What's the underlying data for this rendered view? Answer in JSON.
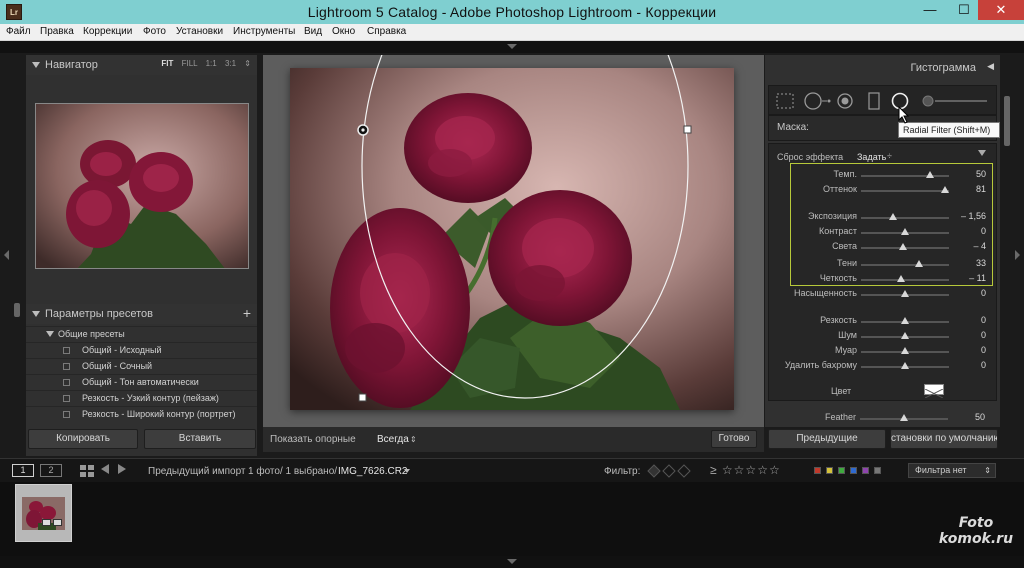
{
  "window": {
    "title": "Lightroom 5 Catalog - Adobe Photoshop Lightroom - Коррекции",
    "app_icon_text": "Lr",
    "minimize": "—",
    "maximize": "☐",
    "close": "✕"
  },
  "menu": [
    "Файл",
    "Правка",
    "Коррекции",
    "Фото",
    "Установки",
    "Инструменты",
    "Вид",
    "Окно",
    "Справка"
  ],
  "navigator": {
    "title": "Навигатор",
    "options": [
      "FIT",
      "FILL",
      "1:1",
      "3:1"
    ],
    "options_arrow": "⇕"
  },
  "presets": {
    "title": "Параметры пресетов",
    "add_icon": "+",
    "folder": "Общие пресеты",
    "items": [
      "Общий - Исходный",
      "Общий - Сочный",
      "Общий - Тон автоматически",
      "Резкость - Узкий контур (пейзаж)",
      "Резкость - Широкий контур (портрет)"
    ]
  },
  "left_buttons": {
    "copy": "Копировать",
    "paste": "Вставить"
  },
  "toolbar": {
    "show_pins_label": "Показать опорные",
    "show_pins_value": "Всегда",
    "done": "Готово"
  },
  "histogram": {
    "title": "Гистограмма",
    "arrow": "◀"
  },
  "tooltip": "Radial Filter (Shift+M)",
  "mask_label": "Маска:",
  "effect": {
    "reset": "Сброс эффекта",
    "preset": "Задать",
    "preset_arrow": "÷"
  },
  "sliders": [
    {
      "label": "Темп.",
      "value": "50",
      "pos": 0.78
    },
    {
      "label": "Оттенок",
      "value": "81",
      "pos": 0.95
    },
    {
      "label": "Экспозиция",
      "value": "– 1,56",
      "pos": 0.36
    },
    {
      "label": "Контраст",
      "value": "0",
      "pos": 0.5
    },
    {
      "label": "Света",
      "value": "– 4",
      "pos": 0.48
    },
    {
      "label": "Тени",
      "value": "33",
      "pos": 0.66
    },
    {
      "label": "Четкость",
      "value": "– 11",
      "pos": 0.45
    },
    {
      "label": "Насыщенность",
      "value": "0",
      "pos": 0.5
    },
    {
      "label": "Резкость",
      "value": "0",
      "pos": 0.5
    },
    {
      "label": "Шум",
      "value": "0",
      "pos": 0.5
    },
    {
      "label": "Муар",
      "value": "0",
      "pos": 0.5
    },
    {
      "label": "Удалить бахрому",
      "value": "0",
      "pos": 0.5
    }
  ],
  "color_label": "Цвет",
  "feather": {
    "label": "Feather",
    "value": "50",
    "pos": 0.5
  },
  "right_buttons": {
    "previous": "Предыдущие",
    "reset_default": "становки по умолчанию."
  },
  "filmbar": {
    "view1": "1",
    "view2": "2",
    "source": "Предыдущий импорт",
    "count": "1 фото/ 1 выбрано/",
    "filename": "IMG_7626.CR2",
    "filter_label": "Фильтр:",
    "no_filter": "Фильтра нет",
    "stars": "≥ ☆☆☆☆☆",
    "color_labels": [
      "#c0392b",
      "#d4c23a",
      "#3faa3f",
      "#2f6ad0",
      "#8e44ad",
      "#777777"
    ]
  },
  "watermark": {
    "line1": "Foto",
    "line2": "komok.ru"
  }
}
